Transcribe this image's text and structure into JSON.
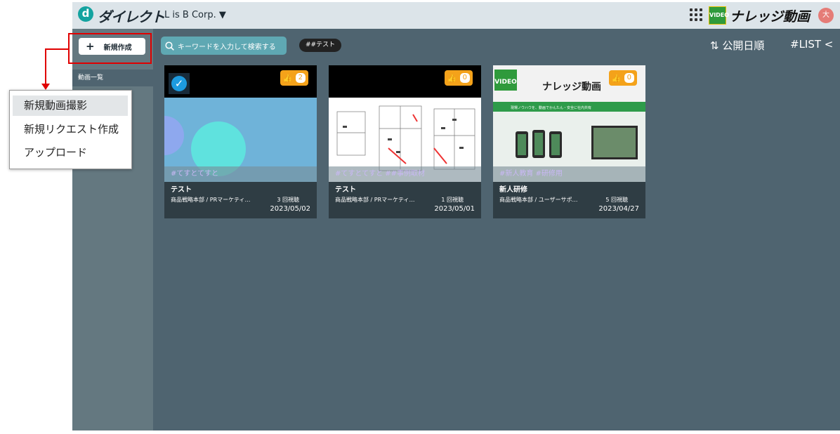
{
  "header": {
    "logo_letter": "d",
    "logo_text": "ダイレクト",
    "company": "L is B Corp. ▼",
    "knowledge_badge": "VIDEO",
    "knowledge_title": "ナレッジ動画",
    "avatar_initial": "大"
  },
  "sidebar": {
    "new_button": "新規作成",
    "items": [
      {
        "label": "動画一覧"
      }
    ]
  },
  "toolbar": {
    "search_placeholder": "キーワードを入力して検索する",
    "tag_filter": "##テスト",
    "sort_label": "⇅ 公開日順",
    "list_toggle": "#LIST <"
  },
  "videos": [
    {
      "likes": "2",
      "tags": "#てすとてすと",
      "title": "テスト",
      "dept": "商品戦略本部 / PRマーケティ…",
      "views": "3 回視聴",
      "date": "2023/05/02",
      "checked": true
    },
    {
      "likes": "0",
      "tags": "#てすとてすと ##事例取材",
      "title": "テスト",
      "dept": "商品戦略本部 / PRマーケティ…",
      "views": "1 回視聴",
      "date": "2023/05/01"
    },
    {
      "likes": "0",
      "tags": "#新人教育 #研修用",
      "title": "新人研修",
      "dept": "商品戦略本部 / ユーザーサポ…",
      "views": "5 回視聴",
      "date": "2023/04/27",
      "slide_title": "ナレッジ動画",
      "slide_subtitle": "現場ノウハウを、動画でかんたん・安全に社内共有"
    }
  ],
  "popup_menu": {
    "items": [
      {
        "label": "新規動画撮影"
      },
      {
        "label": "新規リクエスト作成"
      },
      {
        "label": "アップロード"
      }
    ]
  },
  "colors": {
    "accent": "#14a3a0",
    "annotation": "#e00000",
    "like": "#f4a21a"
  }
}
